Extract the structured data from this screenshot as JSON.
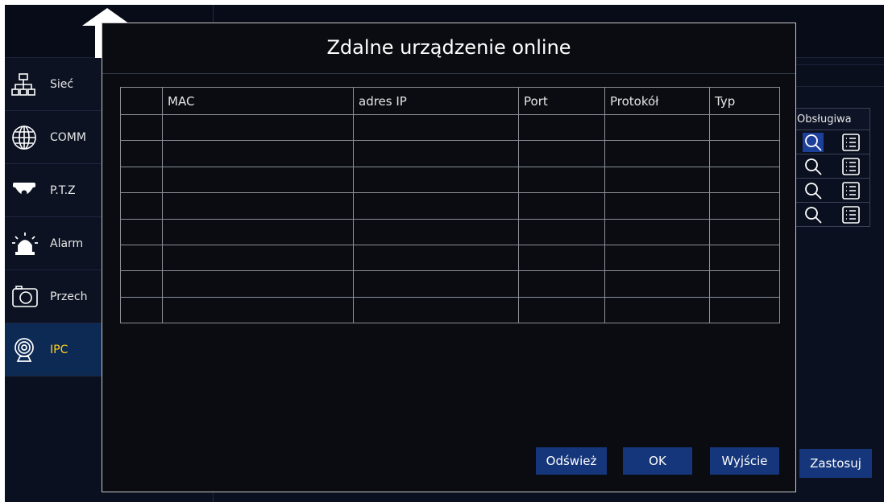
{
  "sidebar": {
    "items": [
      {
        "label": "Sieć",
        "icon": "network-icon"
      },
      {
        "label": "COMM",
        "icon": "globe-icon"
      },
      {
        "label": "P.T.Z",
        "icon": "dome-camera-icon"
      },
      {
        "label": "Alarm",
        "icon": "alarm-light-icon"
      },
      {
        "label": "Przech",
        "icon": "camera-icon"
      },
      {
        "label": "IPC",
        "icon": "ipc-camera-icon"
      }
    ],
    "active_index": 5
  },
  "background": {
    "column_header": "Obsługiwa",
    "rows": 4,
    "apply_button": "Zastosuj"
  },
  "dialog": {
    "title": "Zdalne urządzenie online",
    "table": {
      "columns": [
        "",
        "MAC",
        "adres IP",
        "Port",
        "Protokół",
        "Typ"
      ],
      "row_count": 8
    },
    "buttons": {
      "refresh": "Odśwież",
      "ok": "OK",
      "exit": "Wyjście"
    }
  },
  "colors": {
    "accent": "#15367a",
    "active_label": "#ffd21a",
    "dialog_bg": "#0a0c12"
  }
}
